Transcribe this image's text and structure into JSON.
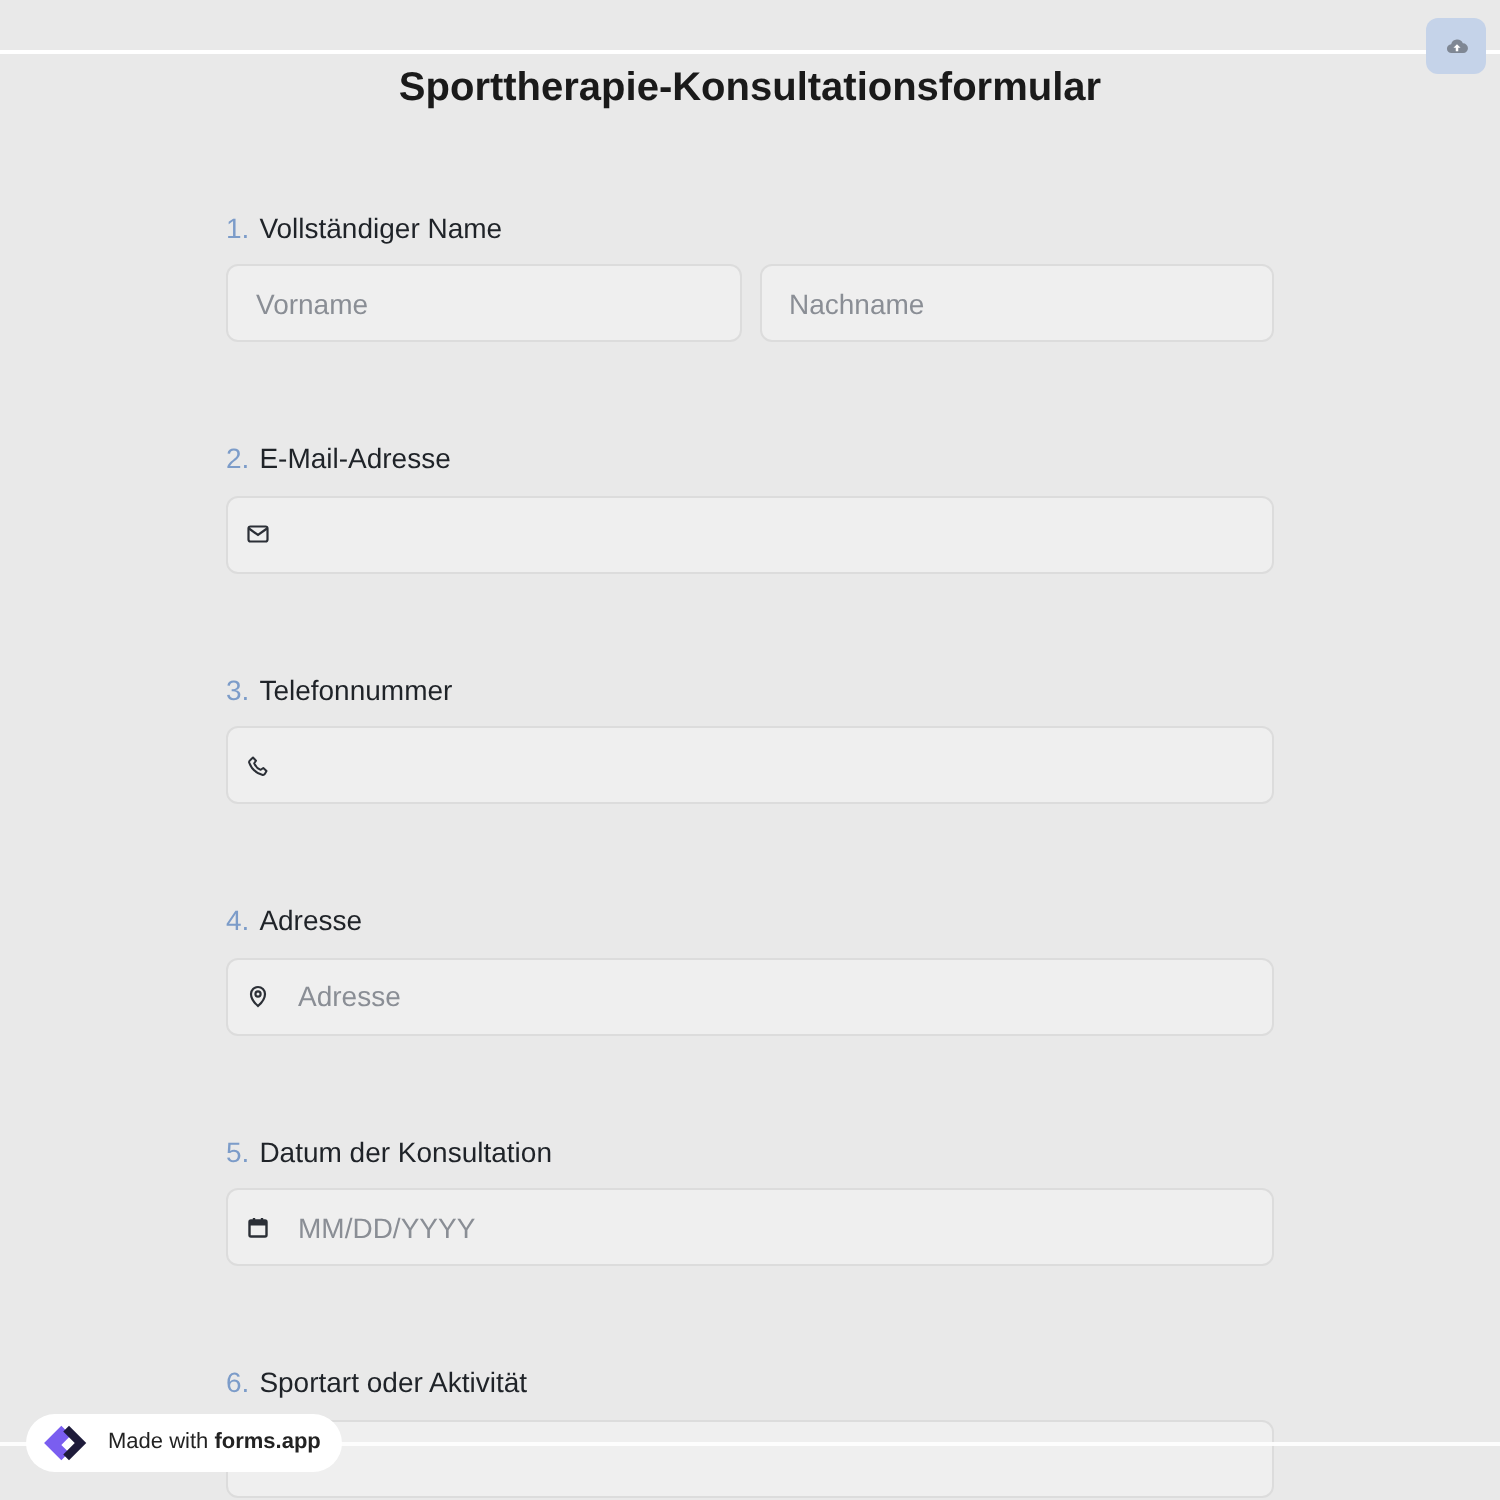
{
  "title": "Sporttherapie-Konsultationsformular",
  "questions": [
    {
      "number": "1.",
      "label": "Vollständiger Name",
      "kind": "name",
      "fields": [
        {
          "placeholder": "Vorname"
        },
        {
          "placeholder": "Nachname"
        }
      ]
    },
    {
      "number": "2.",
      "label": "E-Mail-Adresse",
      "kind": "email"
    },
    {
      "number": "3.",
      "label": "Telefonnummer",
      "kind": "phone"
    },
    {
      "number": "4.",
      "label": "Adresse",
      "kind": "address",
      "placeholder": "Adresse"
    },
    {
      "number": "5.",
      "label": "Datum der Konsultation",
      "kind": "date",
      "placeholder": "MM/DD/YYYY"
    },
    {
      "number": "6.",
      "label": "Sportart oder Aktivität",
      "kind": "text"
    }
  ],
  "badge": {
    "text": "Made with **forms.app**"
  }
}
